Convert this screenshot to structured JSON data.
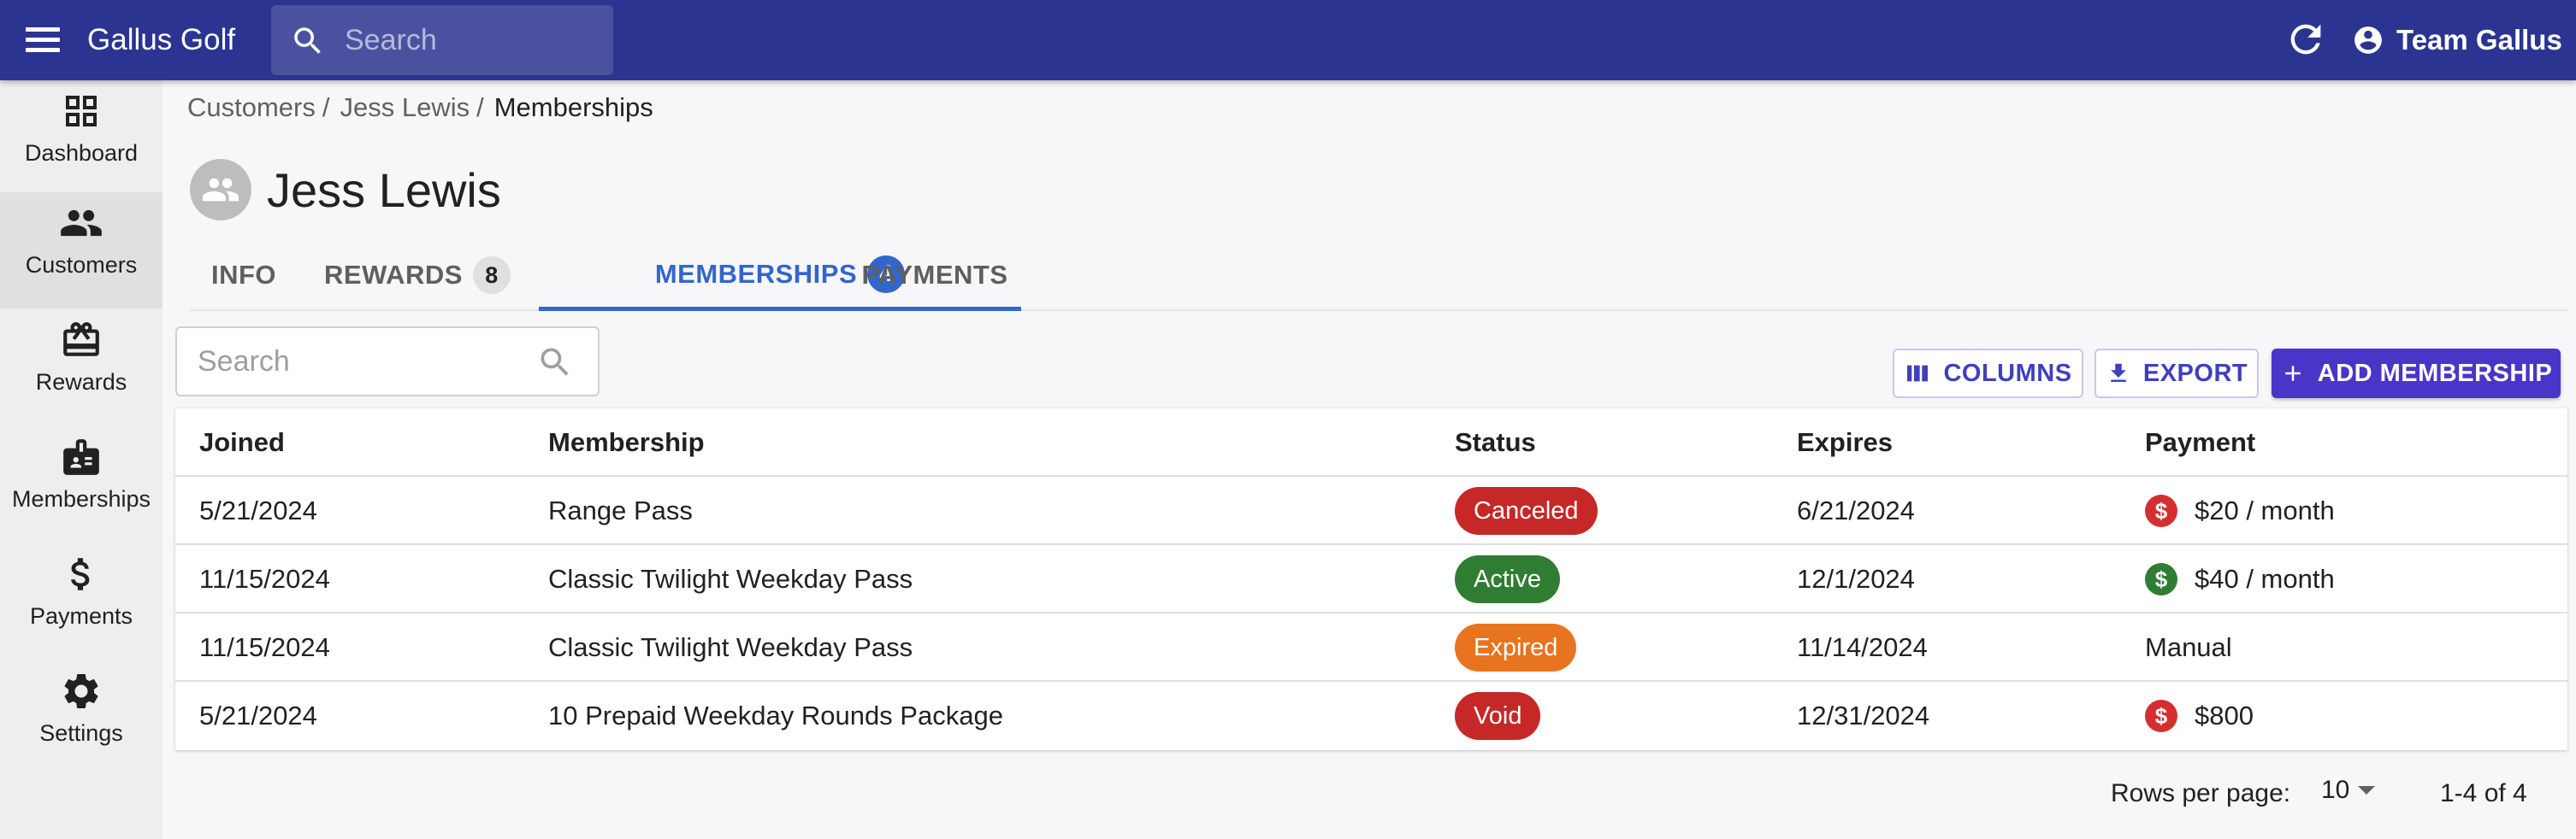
{
  "app": {
    "title": "Gallus Golf",
    "search_placeholder": "Search",
    "account_name": "Team Gallus"
  },
  "icons": {
    "menu": "hamburger-menu-icon",
    "search": "search-icon",
    "refresh": "refresh-icon",
    "account": "account-circle-icon"
  },
  "sidebar": {
    "items": [
      {
        "label": "Dashboard",
        "icon": "dashboard-icon",
        "active": false
      },
      {
        "label": "Customers",
        "icon": "people-icon",
        "active": true
      },
      {
        "label": "Rewards",
        "icon": "gift-card-icon",
        "active": false
      },
      {
        "label": "Memberships",
        "icon": "badge-icon",
        "active": false
      },
      {
        "label": "Payments",
        "icon": "dollar-icon",
        "active": false
      },
      {
        "label": "Settings",
        "icon": "gear-icon",
        "active": false
      }
    ]
  },
  "breadcrumb": {
    "items": [
      "Customers",
      "Jess Lewis"
    ],
    "separator": "/",
    "current": "Memberships"
  },
  "customer": {
    "name": "Jess Lewis"
  },
  "tabs": [
    {
      "label": "INFO",
      "badge": null
    },
    {
      "label": "REWARDS",
      "badge": "8"
    },
    {
      "label": "MEMBERSHIPS",
      "badge": "4",
      "active": true
    },
    {
      "label": "PAYMENTS",
      "badge": null
    }
  ],
  "table_search": {
    "placeholder": "Search"
  },
  "actions": {
    "columns": "COLUMNS",
    "export": "EXPORT",
    "add": "ADD MEMBERSHIP"
  },
  "table": {
    "columns": [
      "Joined",
      "Membership",
      "Status",
      "Expires",
      "Payment"
    ],
    "rows": [
      {
        "joined": "5/21/2024",
        "membership": "Range Pass",
        "status": "Canceled",
        "status_color": "#c62828",
        "expires": "6/21/2024",
        "payment": "$20 / month",
        "payment_icon": "dollar-circle-icon",
        "payment_icon_color": "#d32f2f"
      },
      {
        "joined": "11/15/2024",
        "membership": "Classic Twilight Weekday Pass",
        "status": "Active",
        "status_color": "#2e7d32",
        "expires": "12/1/2024",
        "payment": "$40 / month",
        "payment_icon": "dollar-circle-icon",
        "payment_icon_color": "#2e7d32"
      },
      {
        "joined": "11/15/2024",
        "membership": "Classic Twilight Weekday Pass",
        "status": "Expired",
        "status_color": "#e8741f",
        "expires": "11/14/2024",
        "payment": "Manual",
        "payment_icon": null,
        "payment_icon_color": null
      },
      {
        "joined": "5/21/2024",
        "membership": "10 Prepaid Weekday Rounds Package",
        "status": "Void",
        "status_color": "#c62828",
        "expires": "12/31/2024",
        "payment": "$800",
        "payment_icon": "dollar-circle-icon",
        "payment_icon_color": "#d32f2f"
      }
    ]
  },
  "pagination": {
    "rows_per_page_label": "Rows per page:",
    "rows_per_page": "10",
    "range": "1-4 of 4"
  },
  "colors": {
    "appbar": "#2b3490",
    "accent": "#3366cc",
    "primary_button": "#4a35c9"
  }
}
